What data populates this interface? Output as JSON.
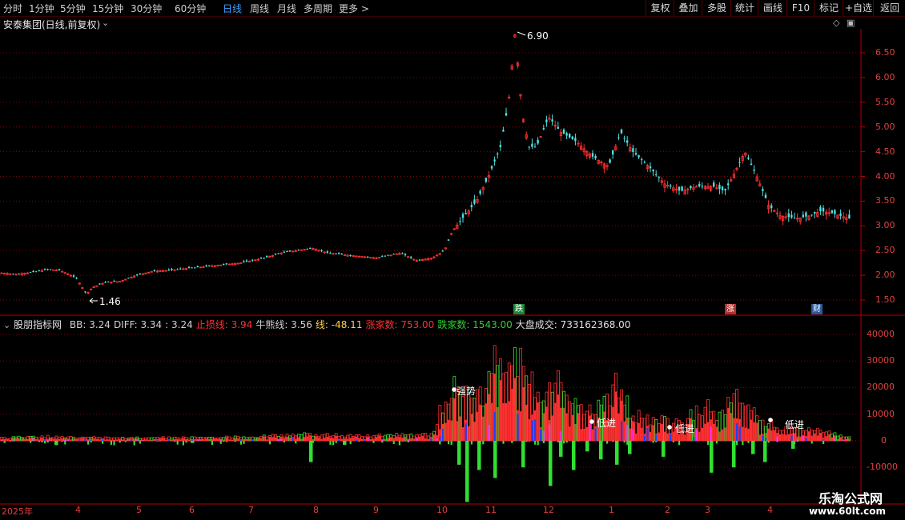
{
  "toolbar": {
    "period_tabs": [
      {
        "label": "分时"
      },
      {
        "label": "1分钟"
      },
      {
        "label": "5分钟"
      },
      {
        "label": "15分钟"
      },
      {
        "label": "30分钟"
      },
      {
        "label": "60分钟"
      },
      {
        "label": "日线"
      },
      {
        "label": "周线"
      },
      {
        "label": "月线"
      },
      {
        "label": "多周期"
      },
      {
        "label": "更多 >"
      }
    ],
    "active_tab": "日线",
    "right_buttons": [
      {
        "label": "复权"
      },
      {
        "label": "叠加"
      },
      {
        "label": "多股"
      },
      {
        "label": "统计"
      },
      {
        "label": "画线"
      },
      {
        "label": "F10"
      },
      {
        "label": "标记"
      },
      {
        "label": "+自选"
      },
      {
        "label": "返回"
      }
    ]
  },
  "price_panel": {
    "title": "安泰集团(日线,前复权)",
    "y_ticks": [
      "6.50",
      "6.00",
      "5.50",
      "5.00",
      "4.50",
      "4.00",
      "3.50",
      "3.00",
      "2.50",
      "2.00",
      "1.50"
    ],
    "high_label": "6.90",
    "low_label": "1.46",
    "badges": [
      {
        "text": "跌",
        "color": "#1a8a3a"
      },
      {
        "text": "涨",
        "color": "#b03030"
      },
      {
        "text": "财",
        "color": "#2a5a9a"
      }
    ]
  },
  "indicator_panel": {
    "name": "股朋指标网",
    "items": [
      {
        "text": "BB: 3.24",
        "color": "#d0d0d0"
      },
      {
        "text": "DIFF: 3.34",
        "color": "#d0d0d0"
      },
      {
        "text": ": 3.24",
        "color": "#d0d0d0"
      },
      {
        "text": "止损线: 3.94",
        "color": "#ff3030"
      },
      {
        "text": "牛熊线: 3.56",
        "color": "#d0d0d0"
      },
      {
        "text": "线: -48.11",
        "color": "#ffd040"
      },
      {
        "text": "涨家数: 753.00",
        "color": "#ff3030"
      },
      {
        "text": "跌家数: 1543.00",
        "color": "#30d030"
      },
      {
        "text": "大盘成交: 733162368.00",
        "color": "#e0e0e0"
      }
    ],
    "y_ticks": [
      "40000",
      "30000",
      "20000",
      "10000",
      "0",
      "-10000"
    ],
    "annotations": [
      "强势",
      "低进",
      "低进",
      "低进"
    ]
  },
  "date_axis": {
    "labels": [
      "2025年",
      "4",
      "5",
      "6",
      "7",
      "8",
      "9",
      "10",
      "11",
      "12",
      "1",
      "2",
      "3",
      "4"
    ]
  },
  "watermark": {
    "line1": "乐淘公式网",
    "line2": "www.60lt.com"
  },
  "colors": {
    "up": "#ff3030",
    "down": "#50e0e0",
    "green": "#30e030",
    "blue": "#1f3fff",
    "magenta": "#ff30ff",
    "grid": "#8a0000"
  },
  "chart_data": {
    "type": "candlestick",
    "price_series_points": [
      [
        0,
        2.05
      ],
      [
        20,
        2.02
      ],
      [
        40,
        2.06
      ],
      [
        60,
        2.12
      ],
      [
        75,
        2.1
      ],
      [
        95,
        1.95
      ],
      [
        108,
        1.62
      ],
      [
        115,
        1.75
      ],
      [
        130,
        1.85
      ],
      [
        150,
        1.88
      ],
      [
        170,
        2.0
      ],
      [
        190,
        2.08
      ],
      [
        210,
        2.1
      ],
      [
        240,
        2.15
      ],
      [
        270,
        2.2
      ],
      [
        300,
        2.25
      ],
      [
        330,
        2.35
      ],
      [
        350,
        2.45
      ],
      [
        370,
        2.5
      ],
      [
        390,
        2.55
      ],
      [
        410,
        2.45
      ],
      [
        440,
        2.4
      ],
      [
        470,
        2.35
      ],
      [
        500,
        2.45
      ],
      [
        520,
        2.3
      ],
      [
        540,
        2.35
      ],
      [
        555,
        2.5
      ],
      [
        565,
        2.9
      ],
      [
        580,
        3.2
      ],
      [
        595,
        3.5
      ],
      [
        610,
        4.0
      ],
      [
        625,
        4.6
      ],
      [
        635,
        5.5
      ],
      [
        643,
        6.9
      ],
      [
        652,
        5.3
      ],
      [
        660,
        4.6
      ],
      [
        670,
        4.6
      ],
      [
        685,
        5.2
      ],
      [
        700,
        4.9
      ],
      [
        720,
        4.7
      ],
      [
        740,
        4.4
      ],
      [
        760,
        4.2
      ],
      [
        775,
        4.9
      ],
      [
        790,
        4.5
      ],
      [
        810,
        4.2
      ],
      [
        830,
        3.85
      ],
      [
        850,
        3.7
      ],
      [
        870,
        3.8
      ],
      [
        890,
        3.8
      ],
      [
        905,
        3.7
      ],
      [
        915,
        4.0
      ],
      [
        930,
        4.5
      ],
      [
        945,
        4.0
      ],
      [
        960,
        3.4
      ],
      [
        975,
        3.2
      ],
      [
        995,
        3.15
      ],
      [
        1010,
        3.2
      ],
      [
        1025,
        3.3
      ],
      [
        1040,
        3.25
      ],
      [
        1060,
        3.15
      ]
    ],
    "indicator_envelope": [
      [
        0,
        1500
      ],
      [
        60,
        2000
      ],
      [
        100,
        1500
      ],
      [
        200,
        1500
      ],
      [
        300,
        1800
      ],
      [
        380,
        3000
      ],
      [
        450,
        2500
      ],
      [
        540,
        3000
      ],
      [
        560,
        25000
      ],
      [
        575,
        30000
      ],
      [
        600,
        20000
      ],
      [
        615,
        38000
      ],
      [
        630,
        30000
      ],
      [
        643,
        42000
      ],
      [
        660,
        28000
      ],
      [
        680,
        18000
      ],
      [
        690,
        32000
      ],
      [
        710,
        20000
      ],
      [
        730,
        12000
      ],
      [
        750,
        15000
      ],
      [
        770,
        26000
      ],
      [
        790,
        12000
      ],
      [
        810,
        10000
      ],
      [
        850,
        8000
      ],
      [
        880,
        16000
      ],
      [
        900,
        12000
      ],
      [
        925,
        24000
      ],
      [
        945,
        12000
      ],
      [
        960,
        8000
      ],
      [
        990,
        6000
      ],
      [
        1020,
        5000
      ],
      [
        1060,
        2000
      ]
    ],
    "green_bars": [
      [
        70,
        -1500
      ],
      [
        240,
        -800
      ],
      [
        388,
        -8000
      ],
      [
        430,
        -1500
      ],
      [
        573,
        -9000
      ],
      [
        583,
        -23000
      ],
      [
        598,
        -11000
      ],
      [
        618,
        -14000
      ],
      [
        653,
        -10000
      ],
      [
        687,
        -17000
      ],
      [
        700,
        -6000
      ],
      [
        716,
        -11000
      ],
      [
        733,
        -4000
      ],
      [
        750,
        -7000
      ],
      [
        770,
        -9000
      ],
      [
        786,
        -5000
      ],
      [
        828,
        -6000
      ],
      [
        888,
        -12000
      ],
      [
        916,
        -10000
      ],
      [
        940,
        -5000
      ],
      [
        955,
        -8000
      ],
      [
        990,
        -3000
      ]
    ]
  }
}
